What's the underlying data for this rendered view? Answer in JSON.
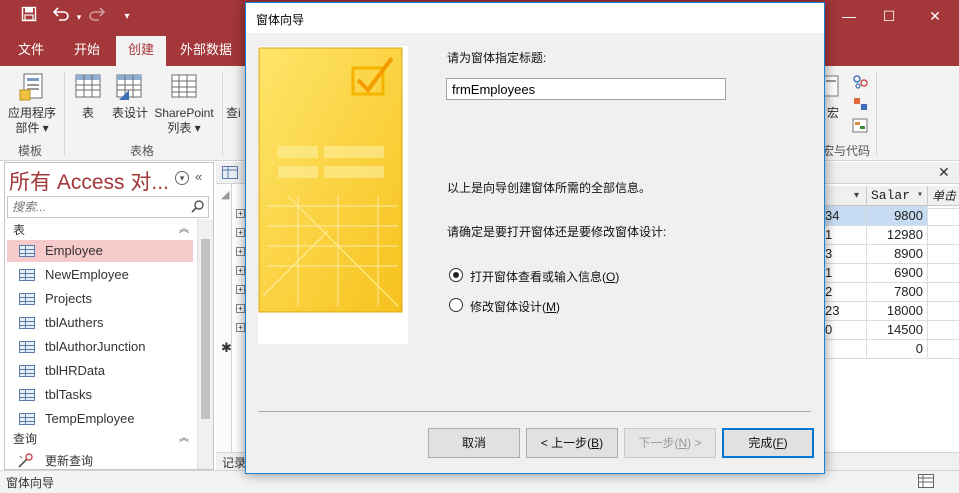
{
  "app": {
    "brand_color": "#a4373a",
    "accent_color": "#0078d7"
  },
  "quick_access": {
    "save_icon": "save-icon",
    "undo_icon": "undo-icon",
    "redo_icon": "redo-icon",
    "customize_icon": "customize-icon"
  },
  "window_controls": {
    "minimize": "—",
    "maximize": "☐",
    "close": "✕"
  },
  "ribbon_tabs": [
    "文件",
    "开始",
    "创建",
    "外部数据"
  ],
  "ribbon_tabs_active": "创建",
  "ribbon": {
    "app_parts_label_1": "应用程序",
    "app_parts_label_2": "部件 ▾",
    "table_label": "表",
    "table_design_label": "表设计",
    "sharepoint_label_1": "SharePoint",
    "sharepoint_label_2": "列表 ▾",
    "query_label_partial": "查i",
    "macro_label_partial": "宏",
    "group_templates": "模板",
    "group_tables": "表格",
    "group_macros_partial": "宏与代码"
  },
  "nav_pane": {
    "title": "所有 Access 对...",
    "search_placeholder": "搜索...",
    "section_tables": "表",
    "section_queries": "查询",
    "tables": [
      "Employee",
      "NewEmployee",
      "Projects",
      "tblAuthers",
      "tblAuthorJunction",
      "tblHRData",
      "tblTasks",
      "TempEmployee"
    ],
    "selected_table": "Employee",
    "queries": [
      "更新查询"
    ]
  },
  "datasheet": {
    "col_header_salary": "Salar",
    "col_header_partial": "单击",
    "left_partial_values": [
      "34",
      "1",
      "3",
      "1",
      "2",
      "23",
      "0"
    ],
    "salary_values": [
      "9800",
      "12980",
      "8900",
      "6900",
      "7800",
      "18000",
      "14500",
      "0"
    ],
    "record_nav_partial": "记录"
  },
  "status_bar": {
    "text": "窗体向导"
  },
  "dialog": {
    "title": "窗体向导",
    "prompt_title": "请为窗体指定标题:",
    "form_title_value": "frmEmployees",
    "info_text": "以上是向导创建窗体所需的全部信息。",
    "question_text": "请确定是要打开窗体还是要修改窗体设计:",
    "option_open_prefix": "打开窗体查看或输入信息(",
    "option_open_key": "O",
    "option_modify_prefix": "修改窗体设计(",
    "option_modify_key": "M",
    "selected_option": "open",
    "btn_cancel": "取消",
    "btn_back_prefix": "< 上一步(",
    "btn_back_key": "B",
    "btn_next_prefix": "下一步(",
    "btn_next_key": "N",
    "btn_next_suffix": ") >",
    "btn_finish_prefix": "完成(",
    "btn_finish_key": "F",
    "close_paren": ")"
  }
}
